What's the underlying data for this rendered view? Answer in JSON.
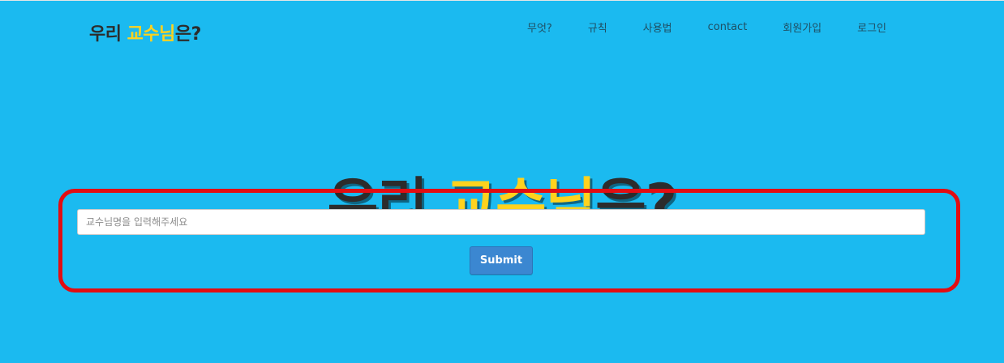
{
  "header": {
    "brand_prefix": "우리 ",
    "brand_accent": "교수님",
    "brand_suffix": "은?"
  },
  "nav": {
    "items": [
      {
        "label": "무엇?"
      },
      {
        "label": "규칙"
      },
      {
        "label": "사용법"
      },
      {
        "label": "contact"
      },
      {
        "label": "회원가입"
      },
      {
        "label": "로그인"
      }
    ]
  },
  "hero": {
    "title_prefix": "우리 ",
    "title_accent": "교수님",
    "title_suffix": "은?"
  },
  "search": {
    "value": "",
    "placeholder": "교수님명을 입력해주세요",
    "submit_label": "Submit"
  },
  "colors": {
    "background": "#1bbaf0",
    "accent": "#ffd21e",
    "text_dark": "#2c2c2c",
    "highlight_border": "#e20d12",
    "button": "#3b87d1"
  }
}
